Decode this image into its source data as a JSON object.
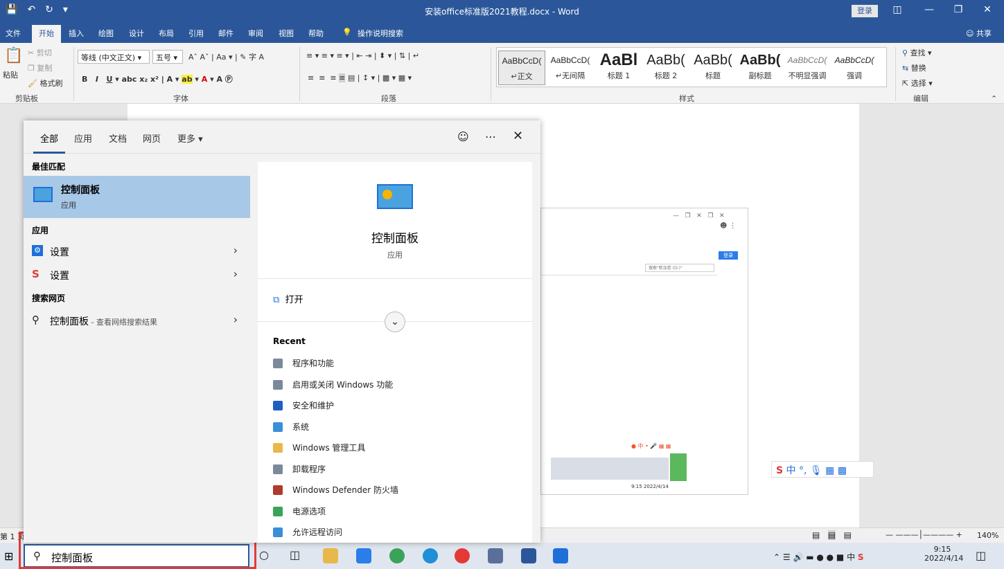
{
  "window": {
    "title": "安装office标准版2021教程.docx  -  Word",
    "login_label": "登录",
    "share_label": "共享"
  },
  "ribbon": {
    "tabs": [
      "文件",
      "开始",
      "插入",
      "绘图",
      "设计",
      "布局",
      "引用",
      "邮件",
      "审阅",
      "视图",
      "帮助"
    ],
    "tell_me": "操作说明搜索",
    "clipboard": {
      "paste": "粘贴",
      "cut": "剪切",
      "copy": "复制",
      "format_painter": "格式刷",
      "label": "剪贴板"
    },
    "font": {
      "name": "等线 (中文正文)",
      "size": "五号",
      "label": "字体"
    },
    "paragraph_label": "段落",
    "styles_label": "样式",
    "styles": [
      {
        "preview": "AaBbCcD(",
        "name": "正文"
      },
      {
        "preview": "AaBbCcD(",
        "name": "无间隔"
      },
      {
        "preview": "AaBl",
        "name": "标题 1"
      },
      {
        "preview": "AaBb(",
        "name": "标题 2"
      },
      {
        "preview": "AaBb(",
        "name": "标题"
      },
      {
        "preview": "AaBb(",
        "name": "副标题"
      },
      {
        "preview": "AaBbCcD(",
        "name": "不明显强调"
      },
      {
        "preview": "AaBbCcD(",
        "name": "强调"
      }
    ],
    "editing": {
      "find": "查找",
      "replace": "替换",
      "select": "选择",
      "label": "编辑"
    }
  },
  "search_panel": {
    "tabs": [
      "全部",
      "应用",
      "文档",
      "网页",
      "更多"
    ],
    "best_match_header": "最佳匹配",
    "best_match": {
      "title": "控制面板",
      "subtitle": "应用"
    },
    "apps_header": "应用",
    "apps": [
      {
        "label": "设置",
        "icon": "gear-icon"
      },
      {
        "label": "设置",
        "icon": "sogou-icon"
      }
    ],
    "web_header": "搜索网页",
    "web_item": {
      "label": "控制面板",
      "suffix": " - 查看网络搜索结果"
    },
    "detail": {
      "title": "控制面板",
      "subtitle": "应用",
      "open_label": "打开",
      "recent_header": "Recent",
      "recent": [
        {
          "label": "程序和功能",
          "color": "#7a8a99"
        },
        {
          "label": "启用或关闭 Windows 功能",
          "color": "#7a8a99"
        },
        {
          "label": "安全和维护",
          "color": "#1f5fbf"
        },
        {
          "label": "系统",
          "color": "#3a8fd8"
        },
        {
          "label": "Windows 管理工具",
          "color": "#e8b84a"
        },
        {
          "label": "卸载程序",
          "color": "#7a8a99"
        },
        {
          "label": "Windows Defender 防火墙",
          "color": "#b03a2e"
        },
        {
          "label": "电源选项",
          "color": "#3aa35a"
        },
        {
          "label": "允许远程访问",
          "color": "#3a8fd8"
        }
      ]
    }
  },
  "search_box": {
    "value": "控制面板"
  },
  "status_bar": {
    "page": "第 1 页",
    "zoom": "140%"
  },
  "taskbar": {
    "time": "9:15",
    "date": "2022/4/14",
    "ime": "中"
  },
  "embedded_screenshot": {
    "search_placeholder": "搜索\"新加卷 (D:)\"",
    "login": "登录",
    "time": "9:15",
    "date": "2022/4/14"
  },
  "colors": {
    "word_blue": "#2b579a",
    "highlight": "#a8c8e8",
    "red_frame": "#e53935"
  }
}
